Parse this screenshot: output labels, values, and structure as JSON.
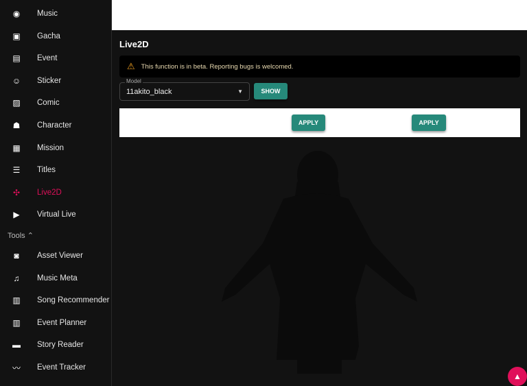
{
  "sidebar": {
    "items": [
      {
        "label": "Music",
        "icon": "disc-icon",
        "glyph": "◉"
      },
      {
        "label": "Gacha",
        "icon": "gacha-icon",
        "glyph": "▣"
      },
      {
        "label": "Event",
        "icon": "calendar-icon",
        "glyph": "▤"
      },
      {
        "label": "Sticker",
        "icon": "sticker-icon",
        "glyph": "☺"
      },
      {
        "label": "Comic",
        "icon": "image-icon",
        "glyph": "▨"
      },
      {
        "label": "Character",
        "icon": "people-icon",
        "glyph": "☗"
      },
      {
        "label": "Mission",
        "icon": "clipboard-icon",
        "glyph": "▦"
      },
      {
        "label": "Titles",
        "icon": "titles-icon",
        "glyph": "☰"
      },
      {
        "label": "Live2D",
        "icon": "live2d-icon",
        "glyph": "✣",
        "active": true
      },
      {
        "label": "Virtual Live",
        "icon": "live-tv-icon",
        "glyph": "▶"
      }
    ],
    "tools_header": "Tools",
    "tools_chevron": "⌃",
    "tools": [
      {
        "label": "Asset Viewer",
        "icon": "asset-search-icon",
        "glyph": "◙"
      },
      {
        "label": "Music Meta",
        "icon": "music-list-icon",
        "glyph": "♫"
      },
      {
        "label": "Song Recommender",
        "icon": "calculator-icon",
        "glyph": "▥"
      },
      {
        "label": "Event Planner",
        "icon": "calculator-icon",
        "glyph": "▥"
      },
      {
        "label": "Story Reader",
        "icon": "chat-icon",
        "glyph": "▬"
      },
      {
        "label": "Event Tracker",
        "icon": "trend-icon",
        "glyph": "〰"
      }
    ]
  },
  "main": {
    "title": "Live2D",
    "alert": "This function is in beta. Reporting bugs is welcomed.",
    "model_label": "Model",
    "model_value": "11akito_black",
    "show": "SHOW",
    "apply1": "APPLY",
    "apply2": "APPLY"
  },
  "colors": {
    "accent": "#e0105a",
    "button": "#26897a"
  }
}
